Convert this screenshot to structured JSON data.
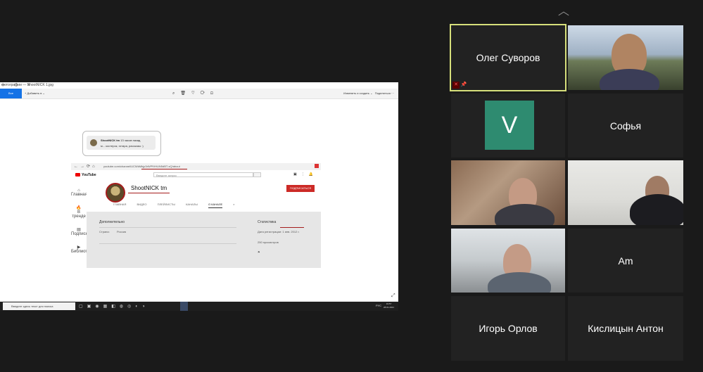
{
  "share": {
    "window_title": "фотографии — ShootNICK 1.jpg",
    "photos_button": "Все фотографии",
    "add_label": "Добавить в",
    "edit_label": "Изменить и создать",
    "share_label": "Поделиться",
    "comment": {
      "name": "ShootNICK tm",
      "time": "13 часов назад",
      "text": "м... костерок, гитара, рассказы :)"
    },
    "browser": {
      "url": "youtube.com/channel/UCWkMhjp3rWPfVHUN5dBT-sQ/about",
      "search_placeholder": "Введите запрос",
      "channel_name": "ShootNICK tm",
      "subscribe": "ПОДПИСАТЬСЯ",
      "tabs": [
        "ГЛАВНАЯ",
        "ВИДЕО",
        "ПЛЕЙЛИСТЫ",
        "КАНАЛЫ",
        "О КАНАЛЕ"
      ],
      "active_tab": "О КАНАЛЕ",
      "sidebar": [
        "Главная",
        "В тренде",
        "Подписки",
        "Библиотека"
      ],
      "more_heading": "Дополнительно",
      "country_label": "Страна:",
      "country_value": "Россия",
      "stats_heading": "Статистика",
      "reg_date": "Дата регистрации: 1 янв. 2012 г.",
      "views": "250 просмотров"
    },
    "taskbar": {
      "search_placeholder": "Введите здесь текст для поиска",
      "tray": "РУС",
      "time": "19:57",
      "date": "28.01.2021"
    }
  },
  "participants": [
    {
      "name": "Олег Суворов",
      "type": "name",
      "active": true
    },
    {
      "name": "",
      "type": "video"
    },
    {
      "name": "Софья",
      "type": "name",
      "avatar_letter": "V"
    },
    {
      "name": "Софья",
      "type": "name"
    },
    {
      "name": "",
      "type": "video"
    },
    {
      "name": "",
      "type": "video"
    },
    {
      "name": "",
      "type": "video"
    },
    {
      "name": "Am",
      "type": "name"
    },
    {
      "name": "Игорь Орлов",
      "type": "name"
    },
    {
      "name": "Кислицын Антон",
      "type": "name"
    }
  ],
  "colors": {
    "active_border": "#d7e07b",
    "avatar_v": "#2e8b70"
  }
}
